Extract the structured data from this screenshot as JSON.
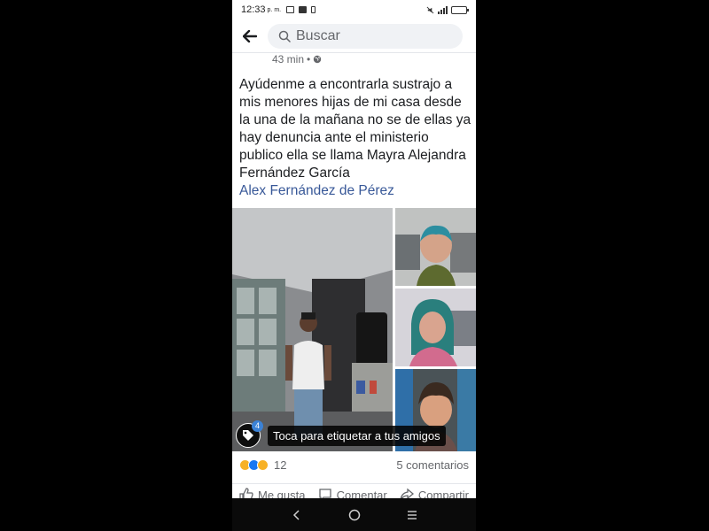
{
  "status_bar": {
    "time": "12:33",
    "ampm": "p. m."
  },
  "search": {
    "placeholder": "Buscar"
  },
  "post": {
    "time_ago": "43 min",
    "separator": "•",
    "text": "Ayúdenme a encontrarla sustrajo a mis menores hijas de mi casa desde la una de la mañana no se de ellas ya hay denuncia ante el ministerio publico ella se llama Mayra Alejandra Fernández García",
    "mention": "Alex Fernández de Pérez",
    "tag_count": "4",
    "tag_prompt": "Toca para etiquetar a tus amigos",
    "reaction_count": "12",
    "comments": "5 comentarios",
    "actions": {
      "like": "Me gusta",
      "comment": "Comentar",
      "share": "Compartir"
    }
  },
  "colors": {
    "link": "#385898",
    "tag_badge": "#3b82d6",
    "reaction_wow": "#f7b125",
    "reaction_like": "#1877f2",
    "reaction_sad": "#f7b125"
  },
  "icons": [
    "back-arrow-icon",
    "search-icon",
    "globe-icon",
    "tag-icon",
    "like-icon",
    "comment-icon",
    "share-icon",
    "nav-back-icon",
    "nav-home-icon",
    "nav-menu-icon"
  ]
}
